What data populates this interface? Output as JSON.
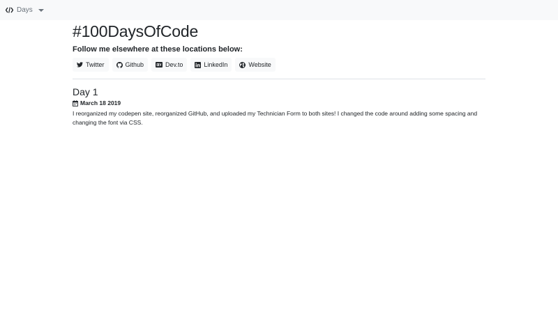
{
  "navbar": {
    "dropdown_label": "Days"
  },
  "header": {
    "title": "#100DaysOfCode",
    "subtitle": "Follow me elsewhere at these locations below:"
  },
  "social_links": [
    {
      "label": "Twitter",
      "icon": "twitter-icon"
    },
    {
      "label": "Github",
      "icon": "github-icon"
    },
    {
      "label": "Dev.to",
      "icon": "devto-icon"
    },
    {
      "label": "LinkedIn",
      "icon": "linkedin-icon"
    },
    {
      "label": "Website",
      "icon": "globe-icon"
    }
  ],
  "entries": [
    {
      "title": "Day 1",
      "date": "March 18 2019",
      "text": "I reorganized my codepen site, reorganized GitHub, and uploaded my Technician Form to both sites! I changed the code around adding some spacing and changing the font via CSS."
    }
  ]
}
